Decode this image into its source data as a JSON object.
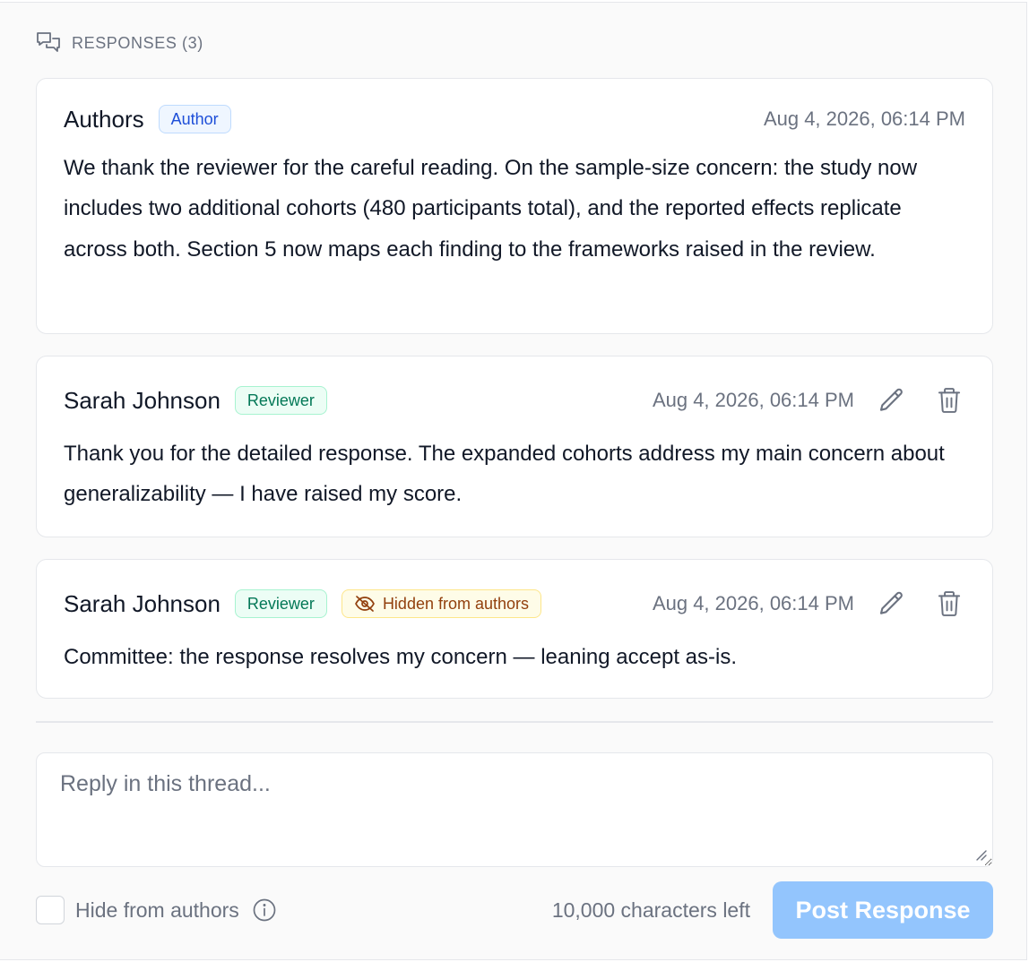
{
  "thread": {
    "header_label": "RESPONSES (3)"
  },
  "responses": [
    {
      "author": "Authors",
      "role_badge": "Author",
      "timestamp": "Aug 4, 2026, 06:14 PM",
      "body": "We thank the reviewer for the careful reading. On the sample-size concern: the study now includes two additional cohorts (480 participants total), and the reported effects replicate across both. Section 5 now maps each finding to the frameworks raised in the review."
    },
    {
      "author": "Sarah Johnson",
      "role_badge": "Reviewer",
      "timestamp": "Aug 4, 2026, 06:14 PM",
      "body": "Thank you for the detailed response. The expanded cohorts address my main concern about generalizability — I have raised my score."
    },
    {
      "author": "Sarah Johnson",
      "role_badge": "Reviewer",
      "visibility_badge": "Hidden from authors",
      "timestamp": "Aug 4, 2026, 06:14 PM",
      "body": "Committee: the response resolves my concern — leaning accept as-is."
    }
  ],
  "reply": {
    "placeholder": "Reply in this thread...",
    "value": "",
    "hide_from_authors_label": "Hide from authors",
    "hide_from_authors_checked": false,
    "chars_left": "10,000 characters left",
    "post_button_label": "Post Response"
  },
  "icons": {
    "header": "chat-bubbles-icon",
    "edit": "pencil-icon",
    "delete": "trash-icon",
    "hidden": "eye-off-icon",
    "info": "info-circle-icon"
  },
  "colors": {
    "author_badge": "#1d4ed8",
    "reviewer_badge": "#047857",
    "hidden_badge": "#92400e",
    "post_button": "#93c5fd"
  }
}
